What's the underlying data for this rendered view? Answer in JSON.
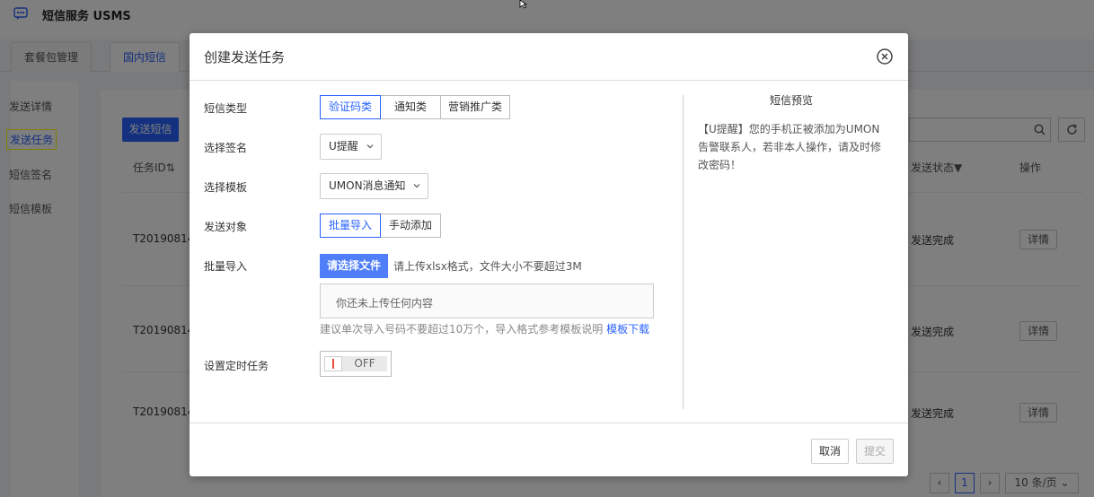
{
  "app": {
    "title": "短信服务 USMS"
  },
  "tabs": [
    {
      "label": "套餐包管理"
    },
    {
      "label": "国内短信"
    }
  ],
  "sidebar": {
    "items": [
      {
        "label": "发送详情"
      },
      {
        "label": "发送任务"
      },
      {
        "label": "短信签名"
      },
      {
        "label": "短信模板"
      }
    ]
  },
  "main": {
    "send_button": "发送短信",
    "headers": {
      "task_id": "任务ID⇅",
      "status": "发送状态▼",
      "action": "操作"
    },
    "rows": [
      {
        "id": "T20190814",
        "status": "发送完成",
        "detail": "详情"
      },
      {
        "id": "T20190814",
        "status": "发送完成",
        "detail": "详情"
      },
      {
        "id": "T20190814",
        "status": "发送完成",
        "detail": "详情"
      }
    ],
    "pager": {
      "page": "1",
      "page_size": "10 条/页"
    }
  },
  "modal": {
    "title": "创建发送任务",
    "sms_type": {
      "label": "短信类型",
      "options": [
        "验证码类",
        "通知类",
        "营销推广类"
      ],
      "selected": 0
    },
    "signature": {
      "label": "选择签名",
      "value": "U提醒"
    },
    "template": {
      "label": "选择模板",
      "value": "UMON消息通知"
    },
    "target": {
      "label": "发送对象",
      "options": [
        "批量导入",
        "手动添加"
      ],
      "selected": 0
    },
    "batch": {
      "label": "批量导入",
      "upload_button": "请选择文件",
      "upload_hint": "请上传xlsx格式，文件大小不要超过3M",
      "empty_text": "你还未上传任何内容",
      "note": "建议单次导入号码不要超过10万个，导入格式参考模板说明",
      "template_link": "模板下载"
    },
    "schedule": {
      "label": "设置定时任务",
      "toggle_state": "OFF"
    },
    "preview": {
      "title": "短信预览",
      "text": "【U提醒】您的手机正被添加为UMON告警联系人，若非本人操作，请及时修改密码！"
    },
    "footer": {
      "cancel": "取消",
      "submit": "提交"
    }
  },
  "colors": {
    "primary": "#2962ff",
    "upload_button": "#4f7ef8",
    "toggle_mark": "#e74c3c"
  }
}
